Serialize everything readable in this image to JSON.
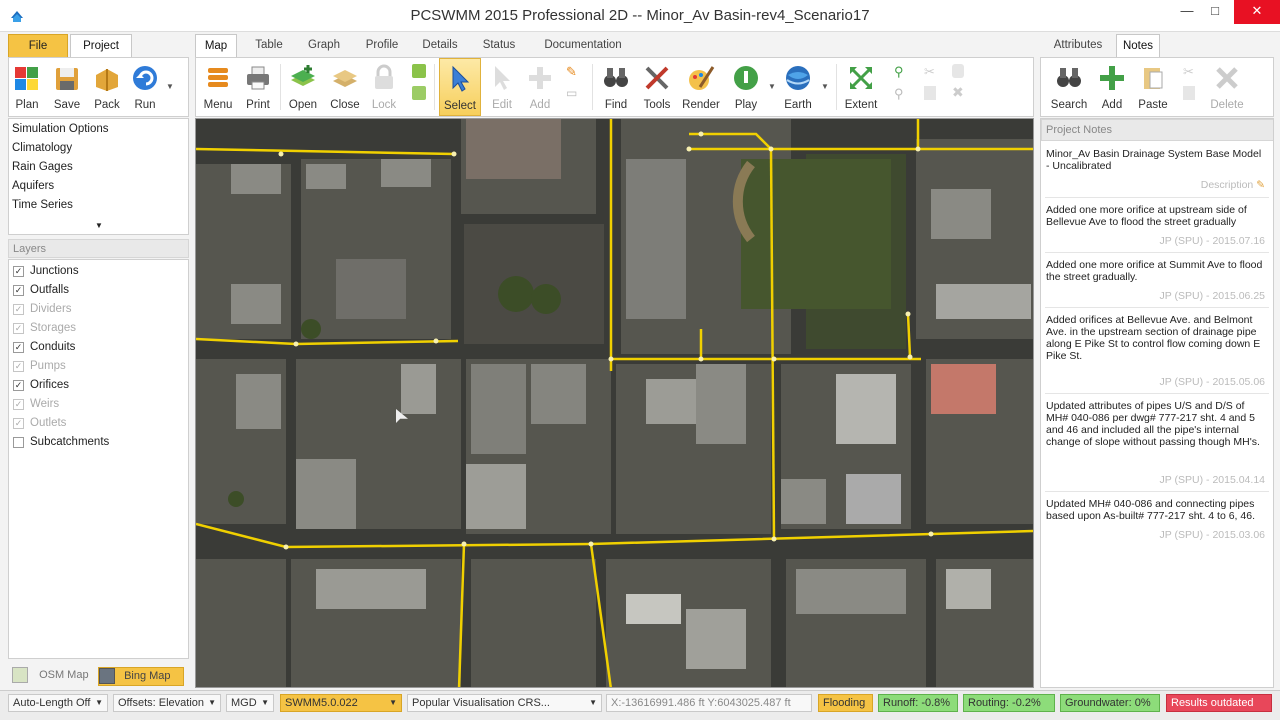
{
  "window": {
    "title": "PCSWMM 2015 Professional 2D -- Minor_Av Basin-rev4_Scenario17"
  },
  "left_tabs": [
    {
      "label": "File"
    },
    {
      "label": "Project"
    }
  ],
  "main_tabs": [
    {
      "label": "Map"
    },
    {
      "label": "Table"
    },
    {
      "label": "Graph"
    },
    {
      "label": "Profile"
    },
    {
      "label": "Details"
    },
    {
      "label": "Status"
    },
    {
      "label": "Documentation"
    }
  ],
  "right_tabs": [
    {
      "label": "Attributes"
    },
    {
      "label": "Notes"
    }
  ],
  "project_ribbon": [
    {
      "label": "Plan"
    },
    {
      "label": "Save"
    },
    {
      "label": "Pack"
    },
    {
      "label": "Run"
    }
  ],
  "map_ribbon": [
    {
      "label": "Menu"
    },
    {
      "label": "Print"
    },
    {
      "label": "Open"
    },
    {
      "label": "Close"
    },
    {
      "label": "Lock"
    },
    {
      "label": "Select"
    },
    {
      "label": "Edit"
    },
    {
      "label": "Add"
    },
    {
      "label": "Find"
    },
    {
      "label": "Tools"
    },
    {
      "label": "Render"
    },
    {
      "label": "Play"
    },
    {
      "label": "Earth"
    },
    {
      "label": "Extent"
    }
  ],
  "notes_ribbon": [
    {
      "label": "Search"
    },
    {
      "label": "Add"
    },
    {
      "label": "Paste"
    },
    {
      "label": "Delete"
    }
  ],
  "project_items": [
    {
      "label": "Simulation Options"
    },
    {
      "label": "Climatology"
    },
    {
      "label": "Rain Gages"
    },
    {
      "label": "Aquifers"
    },
    {
      "label": "Time Series"
    }
  ],
  "layers_header": "Layers",
  "layers": [
    {
      "label": "Junctions",
      "checked": true,
      "enabled": true
    },
    {
      "label": "Outfalls",
      "checked": true,
      "enabled": true
    },
    {
      "label": "Dividers",
      "checked": true,
      "enabled": false
    },
    {
      "label": "Storages",
      "checked": true,
      "enabled": false
    },
    {
      "label": "Conduits",
      "checked": true,
      "enabled": true
    },
    {
      "label": "Pumps",
      "checked": true,
      "enabled": false
    },
    {
      "label": "Orifices",
      "checked": true,
      "enabled": true
    },
    {
      "label": "Weirs",
      "checked": true,
      "enabled": false
    },
    {
      "label": "Outlets",
      "checked": true,
      "enabled": false
    },
    {
      "label": "Subcatchments",
      "checked": false,
      "enabled": true
    }
  ],
  "basemaps": {
    "osm": "OSM Map",
    "bing": "Bing Map"
  },
  "notes": {
    "header": "Project Notes",
    "description": "Minor_Av Basin Drainage System Base Model - Uncalibrated",
    "description_label": "Description",
    "entries": [
      {
        "text": "Added one more orifice at upstream side of Bellevue Ave to flood the street gradually",
        "meta": "JP (SPU) - 2015.07.16"
      },
      {
        "text": "Added one more orifice at Summit Ave to flood the street gradually.",
        "meta": "JP (SPU) - 2015.06.25"
      },
      {
        "text": "Added orifices at Bellevue Ave. and Belmont Ave. in the upstream section of drainage pipe along E Pike St to control flow coming down E Pike St.",
        "meta": "JP (SPU) - 2015.05.06"
      },
      {
        "text": "Updated attributes of pipes U/S and D/S of MH# 040-086 per dwg# 777-217 sht. 4 and 5 and 46 and included all the pipe's internal change of slope without passing though MH's.",
        "meta": "JP (SPU) - 2015.04.14"
      },
      {
        "text": "Updated MH# 040-086 and connecting pipes based upon As-built# 777-217 sht. 4 to 6, 46.",
        "meta": "JP (SPU) - 2015.03.06"
      }
    ]
  },
  "status": {
    "auto_length": "Auto-Length Off",
    "offsets": "Offsets: Elevation",
    "units": "MGD",
    "engine": "SWMM5.0.022",
    "crs": "Popular Visualisation CRS...",
    "coords": "X:-13616991.486 ft  Y:6043025.487 ft",
    "flooding": "Flooding",
    "runoff": "Runoff: -0.8%",
    "routing": "Routing: -0.2%",
    "groundwater": "Groundwater: 0%",
    "results": "Results outdated"
  },
  "colors": {
    "accent": "#f5c344",
    "conduit": "#f0d000",
    "flooding": "#f5c344",
    "ok": "#8ddc7a",
    "error": "#e8475a"
  }
}
